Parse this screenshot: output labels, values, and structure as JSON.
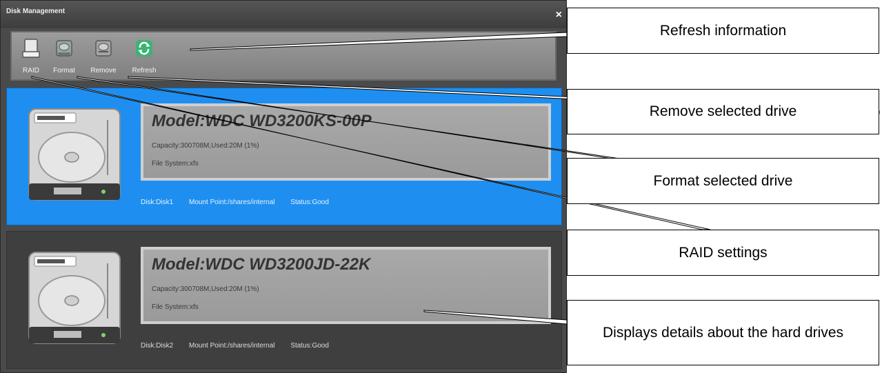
{
  "window": {
    "title": "Disk Management",
    "close_glyph": "×"
  },
  "toolbar": {
    "items": [
      {
        "label": "RAID",
        "icon": "raid-icon"
      },
      {
        "label": "Format",
        "icon": "format-icon"
      },
      {
        "label": "Remove",
        "icon": "remove-icon"
      },
      {
        "label": "Refresh",
        "icon": "refresh-icon"
      }
    ]
  },
  "drives": [
    {
      "model": "Model:WDC WD3200KS-00P",
      "capacity": "Capacity:300708M,Used:20M (1%)",
      "file_system": "File System:xfs",
      "disk": "Disk:Disk1",
      "mount_point": "Mount Point:/shares/internal",
      "status": "Status:Good",
      "selected": true
    },
    {
      "model": "Model:WDC WD3200JD-22K",
      "capacity": "Capacity:300708M,Used:20M (1%)",
      "file_system": "File System:xfs",
      "disk": "Disk:Disk2",
      "mount_point": "Mount Point:/shares/internal",
      "status": "Status:Good",
      "selected": false
    }
  ],
  "annotations": {
    "refresh": "Refresh information",
    "remove": "Remove selected drive",
    "format": "Format selected drive",
    "raid": "RAID settings",
    "details": "Displays details about the hard drives"
  },
  "colors": {
    "selected_panel": "#1e8ff0",
    "window_bg": "#4a4a4a",
    "refresh_icon": "#3cb371"
  }
}
